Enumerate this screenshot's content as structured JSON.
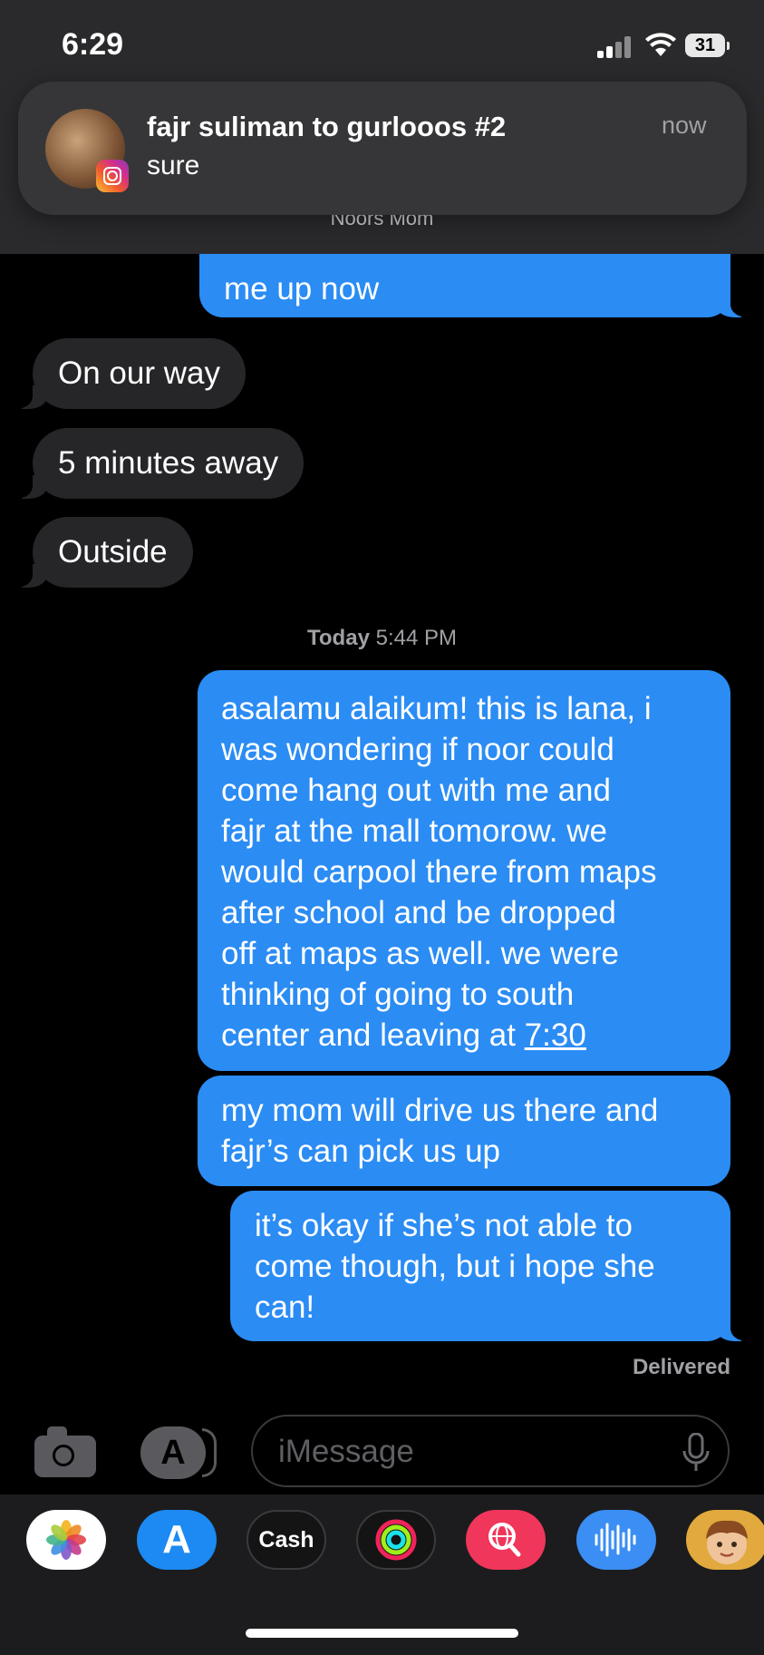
{
  "status_bar": {
    "time": "6:29",
    "battery": "31"
  },
  "notification": {
    "title": "fajr suliman to gurlooos #2",
    "body": "sure",
    "time": "now",
    "app_icon": "instagram-icon"
  },
  "conversation": {
    "contact_name": "Noors Mom",
    "partial_message": "me up now",
    "received": [
      "On our way",
      "5 minutes away",
      "Outside"
    ],
    "timestamp_day": "Today",
    "timestamp_time": "5:44 PM",
    "sent": {
      "message_1_lines": [
        "asalamu alaikum! this is lana, i",
        "was wondering if noor could",
        "come hang out with me and",
        "fajr at the mall tomorow. we",
        "would carpool there from maps",
        "after school and be dropped",
        "off at maps as well. we were",
        "thinking of going to south"
      ],
      "message_1_last_prefix": "center and leaving at ",
      "message_1_last_link": "7:30",
      "message_2_lines": [
        "my mom will drive us there and",
        "fajr’s can pick us up"
      ],
      "message_3_lines": [
        "it’s okay if she’s not able to",
        "come though, but i hope she",
        "can!"
      ]
    },
    "status": "Delivered"
  },
  "input_bar": {
    "placeholder": "iMessage"
  },
  "app_drawer": {
    "cash_label": "Cash",
    "apps": [
      "photos-icon",
      "app-store-icon",
      "apple-cash-icon",
      "fitness-icon",
      "image-search-icon",
      "audio-message-icon",
      "memoji-icon"
    ]
  },
  "colors": {
    "sent_bubble": "#2b8cf4",
    "received_bubble": "#262629",
    "background": "#000000"
  }
}
